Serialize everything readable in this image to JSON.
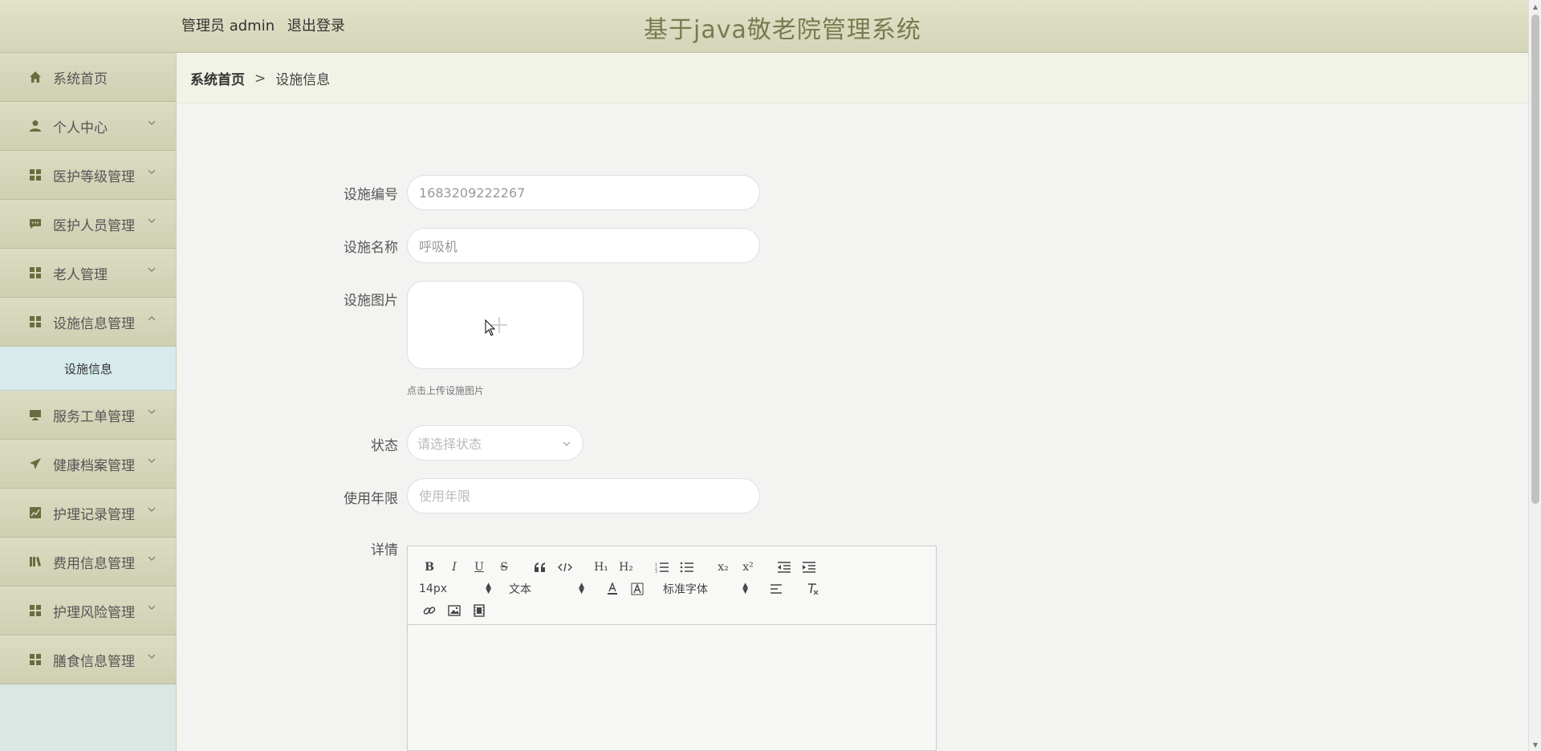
{
  "header": {
    "user_label": "管理员 admin",
    "logout_label": "退出登录",
    "title": "基于java敬老院管理系统"
  },
  "sidebar": {
    "items": [
      {
        "label": "系统首页",
        "icon": "home-icon",
        "has_chevron": false
      },
      {
        "label": "个人中心",
        "icon": "user-icon",
        "has_chevron": true
      },
      {
        "label": "医护等级管理",
        "icon": "grid-icon",
        "has_chevron": true
      },
      {
        "label": "医护人员管理",
        "icon": "chat-icon",
        "has_chevron": true
      },
      {
        "label": "老人管理",
        "icon": "grid-icon",
        "has_chevron": true
      },
      {
        "label": "设施信息管理",
        "icon": "grid-icon",
        "has_chevron": true,
        "expanded": true
      },
      {
        "label": "服务工单管理",
        "icon": "monitor-icon",
        "has_chevron": true
      },
      {
        "label": "健康档案管理",
        "icon": "send-icon",
        "has_chevron": true
      },
      {
        "label": "护理记录管理",
        "icon": "chart-icon",
        "has_chevron": true
      },
      {
        "label": "费用信息管理",
        "icon": "book-icon",
        "has_chevron": true
      },
      {
        "label": "护理风险管理",
        "icon": "grid-icon",
        "has_chevron": true
      },
      {
        "label": "膳食信息管理",
        "icon": "grid-icon",
        "has_chevron": true
      }
    ],
    "sub_item": "设施信息"
  },
  "breadcrumb": {
    "home": "系统首页",
    "separator": ">",
    "current": "设施信息"
  },
  "form": {
    "facility_no": {
      "label": "设施编号",
      "value": "1683209222267"
    },
    "facility_name": {
      "label": "设施名称",
      "value": "呼吸机"
    },
    "facility_image": {
      "label": "设施图片",
      "tip": "点击上传设施图片"
    },
    "status": {
      "label": "状态",
      "placeholder": "请选择状态"
    },
    "years": {
      "label": "使用年限",
      "placeholder": "使用年限"
    },
    "details": {
      "label": "详情"
    }
  },
  "editor": {
    "font_size": "14px",
    "paragraph": "文本",
    "font_family": "标准字体",
    "buttons": {
      "bold": "B",
      "italic": "I",
      "underline": "U",
      "strike": "S",
      "h1": "H₁",
      "h2": "H₂",
      "sub": "x₂",
      "sup": "x²"
    }
  },
  "colors": {
    "header_bg": "#d8d8bc",
    "sidebar_item_bg": "#d6d6bb",
    "sub_item_bg": "#d7ebec",
    "breadcrumb_bg": "#f0f3e6",
    "accent_icon": "#6b6b3f",
    "title": "#7a7a50"
  }
}
